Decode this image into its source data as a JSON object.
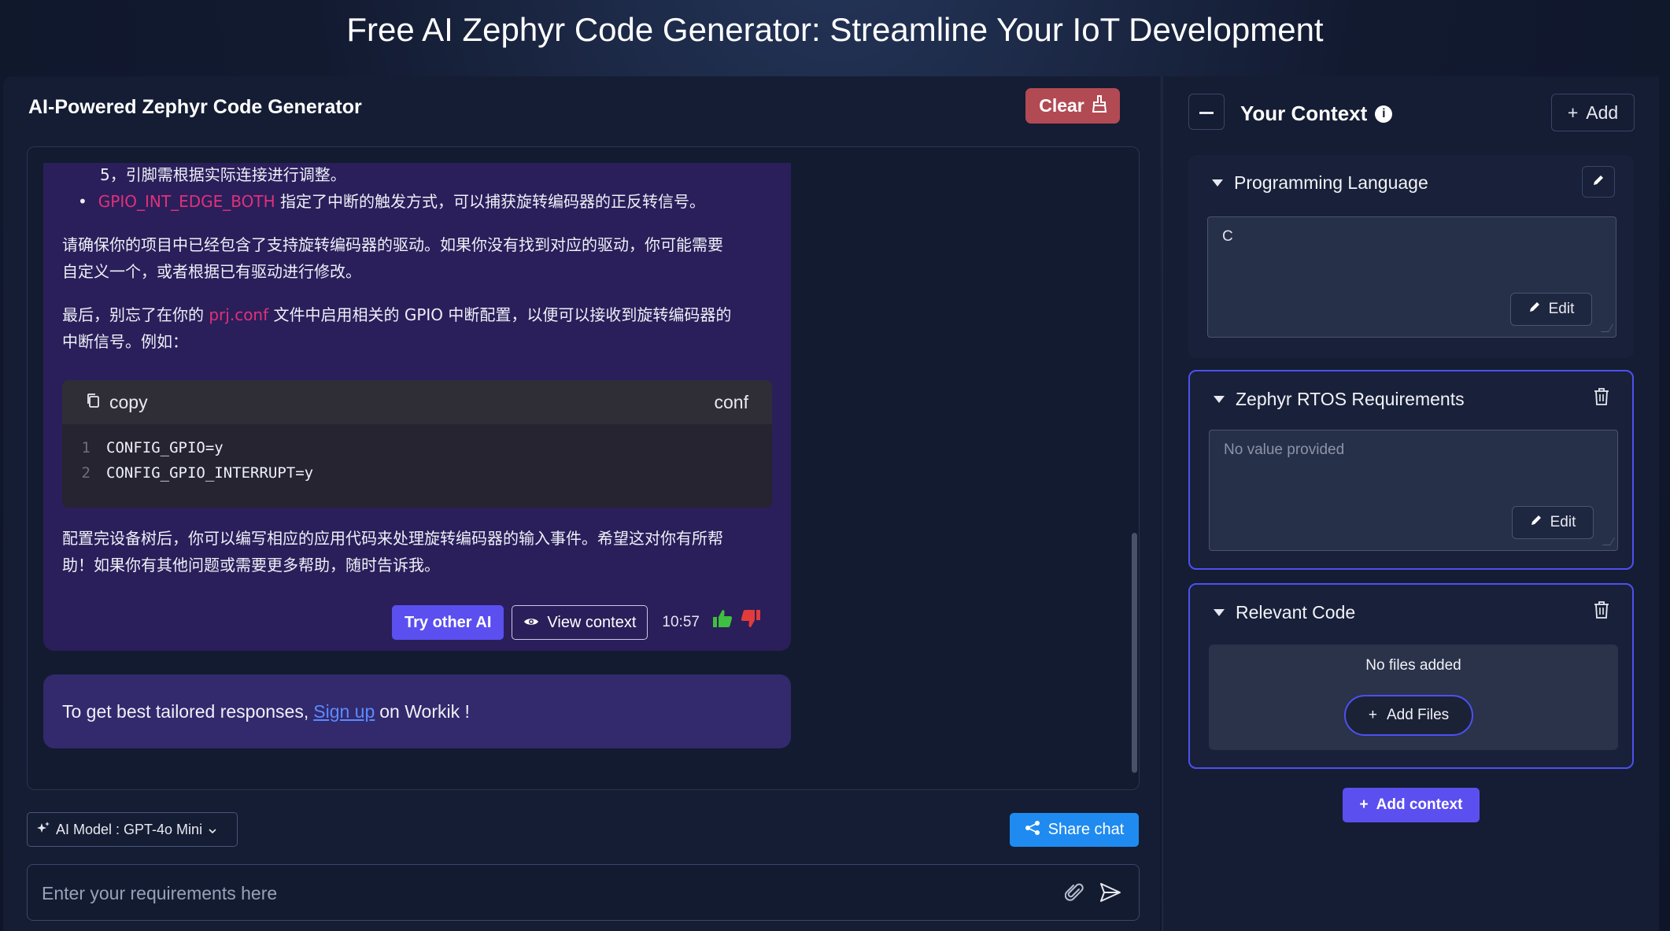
{
  "page": {
    "title": "Free AI Zephyr Code Generator: Streamline Your IoT Development"
  },
  "generator": {
    "title": "AI-Powered Zephyr Code Generator",
    "clear_label": "Clear"
  },
  "message": {
    "line1": "5，引脚需根据实际连接进行调整。",
    "bullet_code": "GPIO_INT_EDGE_BOTH",
    "bullet_text": " 指定了中断的触发方式，可以捕获旋转编码器的正反转信号。",
    "para1_line1": "请确保你的项目中已经包含了支持旋转编码器的驱动。如果你没有找到对应的驱动，你可能需要",
    "para1_line2": "自定义一个，或者根据已有驱动进行修改。",
    "para2_pre": "最后，别忘了在你的 ",
    "para2_code": "prj.conf",
    "para2_post": " 文件中启用相关的 GPIO 中断配置，以便可以接收到旋转编码器的",
    "para2_line2": "中断信号。例如：",
    "code": {
      "copy_label": "copy",
      "language": "conf",
      "lines": [
        {
          "num": "1",
          "text": "CONFIG_GPIO=y"
        },
        {
          "num": "2",
          "text": "CONFIG_GPIO_INTERRUPT=y"
        }
      ]
    },
    "para3_line1": "配置完设备树后，你可以编写相应的应用代码来处理旋转编码器的输入事件。希望这对你有所帮",
    "para3_line2": "助！如果你有其他问题或需要更多帮助，随时告诉我。",
    "actions": {
      "try_other": "Try other AI",
      "view_context": "View  context",
      "time": "10:57"
    }
  },
  "signup": {
    "prefix": "To get best tailored responses,",
    "link": "Sign up",
    "suffix": "on Workik !"
  },
  "footer": {
    "model_label": "AI Model : GPT-4o Mini",
    "share_label": "Share chat",
    "input_placeholder": "Enter your requirements here"
  },
  "context": {
    "title": "Your Context",
    "add_label": "Add",
    "cards": {
      "language": {
        "title": "Programming Language",
        "value": "C",
        "edit_label": "Edit"
      },
      "requirements": {
        "title": "Zephyr RTOS Requirements",
        "placeholder": "No value provided",
        "edit_label": "Edit"
      },
      "code": {
        "title": "Relevant Code",
        "empty_label": "No files added",
        "add_files_label": "Add Files"
      }
    },
    "add_context_label": "Add context"
  },
  "colors": {
    "accent": "#5b4ff0",
    "clear": "#b24a54",
    "share": "#1f8bf0",
    "highlight": "#e0317b",
    "thumbs_up": "#3fbf3f",
    "thumbs_down": "#e23b3b"
  }
}
